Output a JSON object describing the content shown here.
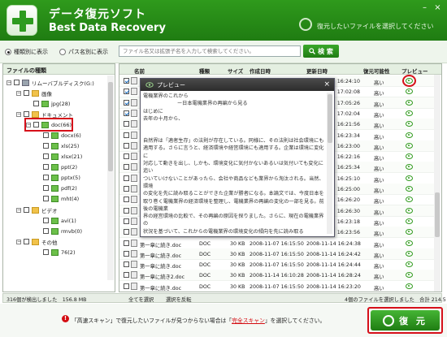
{
  "header": {
    "title_jp": "データ復元ソフト",
    "title_en": "Best Data Recovery",
    "hint": "復元したいファイルを選択してください",
    "window_controls": [
      "–",
      "×"
    ]
  },
  "toolbar": {
    "radio_type": "種類別に表示",
    "radio_path": "パス名別に表示",
    "search_placeholder": "ファイル名又は拡張子名を入力して検索してください。",
    "search_button": "検 索"
  },
  "tree": {
    "header": "ファイルの種類",
    "items": [
      {
        "label": "リムーバブルディスク(G:)",
        "icon": "drive-icon",
        "expander": "−"
      },
      {
        "label": "画像",
        "icon": "folder-icon",
        "expander": "−"
      },
      {
        "label": "jpg(28)",
        "icon": "folder-green-icon"
      },
      {
        "label": "ドキュメント",
        "icon": "folder-icon",
        "expander": "−"
      },
      {
        "label": "doc(66)",
        "icon": "folder-green-icon",
        "expander": "−",
        "selected": true
      },
      {
        "label": "docx(6)",
        "icon": "folder-green-icon"
      },
      {
        "label": "xls(25)",
        "icon": "folder-green-icon"
      },
      {
        "label": "xlsx(21)",
        "icon": "folder-green-icon"
      },
      {
        "label": "ppt(2)",
        "icon": "folder-green-icon"
      },
      {
        "label": "pptx(5)",
        "icon": "folder-green-icon"
      },
      {
        "label": "pdf(2)",
        "icon": "folder-green-icon"
      },
      {
        "label": "mht(4)",
        "icon": "folder-green-icon"
      },
      {
        "label": "ビデオ",
        "icon": "folder-icon",
        "expander": "−"
      },
      {
        "label": "avi(1)",
        "icon": "folder-green-icon"
      },
      {
        "label": "rmvb(0)",
        "icon": "folder-green-icon"
      },
      {
        "label": "その他",
        "icon": "folder-icon",
        "expander": "−"
      },
      {
        "label": "76(2)",
        "icon": "folder-green-icon"
      }
    ]
  },
  "list": {
    "columns": [
      "名前",
      "種類",
      "サイズ",
      "作成日時",
      "更新日時",
      "復元可能性",
      "プレビュー"
    ],
    "rows": [
      {
        "name": "",
        "type": "",
        "size": "",
        "created": "",
        "modified": "16:24:10",
        "status": "高い",
        "checked": true
      },
      {
        "name": "",
        "type": "",
        "size": "",
        "created": "",
        "modified": "17:02:08",
        "status": "高い",
        "checked": true
      },
      {
        "name": "",
        "type": "",
        "size": "",
        "created": "",
        "modified": "17:05:26",
        "status": "高い",
        "checked": true
      },
      {
        "name": "",
        "type": "",
        "size": "",
        "created": "",
        "modified": "17:02:04",
        "status": "高い",
        "checked": true
      },
      {
        "name": "",
        "type": "",
        "size": "",
        "created": "",
        "modified": "16:21:56",
        "status": "高い",
        "checked": false
      },
      {
        "name": "",
        "type": "",
        "size": "",
        "created": "",
        "modified": "16:23:34",
        "status": "高い",
        "checked": false
      },
      {
        "name": "",
        "type": "",
        "size": "",
        "created": "",
        "modified": "16:23:00",
        "status": "高い",
        "checked": false
      },
      {
        "name": "",
        "type": "",
        "size": "",
        "created": "",
        "modified": "16:22:16",
        "status": "高い",
        "checked": false
      },
      {
        "name": "",
        "type": "",
        "size": "",
        "created": "",
        "modified": "16:25:34",
        "status": "高い",
        "checked": false
      },
      {
        "name": "",
        "type": "",
        "size": "",
        "created": "",
        "modified": "16:25:10",
        "status": "高い",
        "checked": false
      },
      {
        "name": "",
        "type": "",
        "size": "",
        "created": "",
        "modified": "16:25:00",
        "status": "高い",
        "checked": false
      },
      {
        "name": "",
        "type": "",
        "size": "",
        "created": "",
        "modified": "16:26:20",
        "status": "高い",
        "checked": false
      },
      {
        "name": "",
        "type": "",
        "size": "",
        "created": "",
        "modified": "16:26:30",
        "status": "高い",
        "checked": false
      },
      {
        "name": "",
        "type": "",
        "size": "",
        "created": "",
        "modified": "16:23:18",
        "status": "高い",
        "checked": false
      },
      {
        "name": "",
        "type": "",
        "size": "",
        "created": "",
        "modified": "16:23:56",
        "status": "高い",
        "checked": false
      },
      {
        "name": "第一章に続き.doc",
        "type": "DOC",
        "size": "30 KB",
        "created": "2008-11-07 16:15:50",
        "modified": "2008-11-14 16:24:38",
        "status": "高い",
        "checked": false
      },
      {
        "name": "第一章に続き.doc",
        "type": "DOC",
        "size": "30 KB",
        "created": "2008-11-07 16:15:50",
        "modified": "2008-11-14 16:24:42",
        "status": "高い",
        "checked": false
      },
      {
        "name": "第一章に続き.doc",
        "type": "DOC",
        "size": "30 KB",
        "created": "2008-11-07 16:15:50",
        "modified": "2008-11-14 16:24:44",
        "status": "高い",
        "checked": false
      },
      {
        "name": "第一章に続き2.doc",
        "type": "DOC",
        "size": "30 KB",
        "created": "2008-11-14 16:10:28",
        "modified": "2008-11-14 16:28:24",
        "status": "高い",
        "checked": false
      },
      {
        "name": "第一章に続き.doc",
        "type": "DOC",
        "size": "30 KB",
        "created": "2008-11-07 16:15:50",
        "modified": "2008-11-14 16:23:20",
        "status": "高い",
        "checked": false
      }
    ]
  },
  "preview": {
    "title": "プレビュー",
    "close": "×",
    "lines": [
      "電機業界のこれから",
      "ー日本電機業界の再編から見る",
      "はじめに",
      "去年の十月から、",
      "",
      "",
      "自然界は「適者生存」の法則が存在している。同様に、その法則は社会環境にも",
      "適用する。さらに言うと、経済環境や経営環境にも適用する。企業は環境に変化に",
      "対応して動きを出し、しかも、環境変化に気付かないあるいは気付いても変化に追い",
      "ついていけないことがあったら、会社や商品なども業界から淘汰される。当然、環境",
      "の変化を先に読み取ることができた企業が勝者になる。本論文では、今度日本を",
      "取り巻く電機業界の経済環境を整理し、電機業界の再編の変化の一部を見る。前後の電機業",
      "界の経営環境の比較で、その再編の原因を探りました。さらに、現在の電機業界の",
      "状況を基づいて、これからの電機業界の環境変化の傾向を先に読み取る"
    ]
  },
  "footer_bar": {
    "found": "316個が検出しました　156.8 MB",
    "select_all": "全てを選択",
    "invert": "選択を反転",
    "selected": "4個のファイルを選択しました　合計 214.5 KB"
  },
  "bottom": {
    "warn_mark": "!",
    "hint_pre": "「高速スキャン」で復元したいファイルが見つからない場合は「",
    "hint_link": "完全スキャン",
    "hint_post": "」を選択してください。",
    "recover_button": "復 元"
  }
}
